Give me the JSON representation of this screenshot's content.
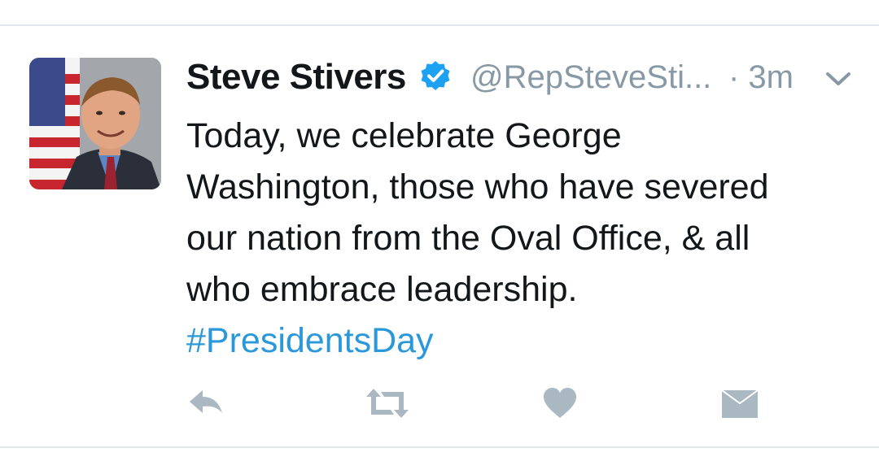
{
  "user": {
    "name": "Steve Stivers",
    "handle": "@RepSteveSti...",
    "time": "· 3m",
    "verified": true
  },
  "tweet": {
    "lines": [
      "Today, we celebrate George",
      "Washington, those who have severed",
      "our nation from the Oval Office, & all",
      "who embrace leadership."
    ],
    "hashtag": "#PresidentsDay"
  },
  "icons": {
    "verified": "verified-badge-icon",
    "menu": "chevron-down-icon",
    "reply": "reply-icon",
    "retweet": "retweet-icon",
    "like": "heart-icon",
    "dm": "envelope-icon"
  },
  "colors": {
    "text": "#14171a",
    "muted": "#8899a6",
    "link": "#2b98d9",
    "verified": "#1da1f2",
    "action_icons": "#aab8c2",
    "divider": "#e1e8ed"
  }
}
